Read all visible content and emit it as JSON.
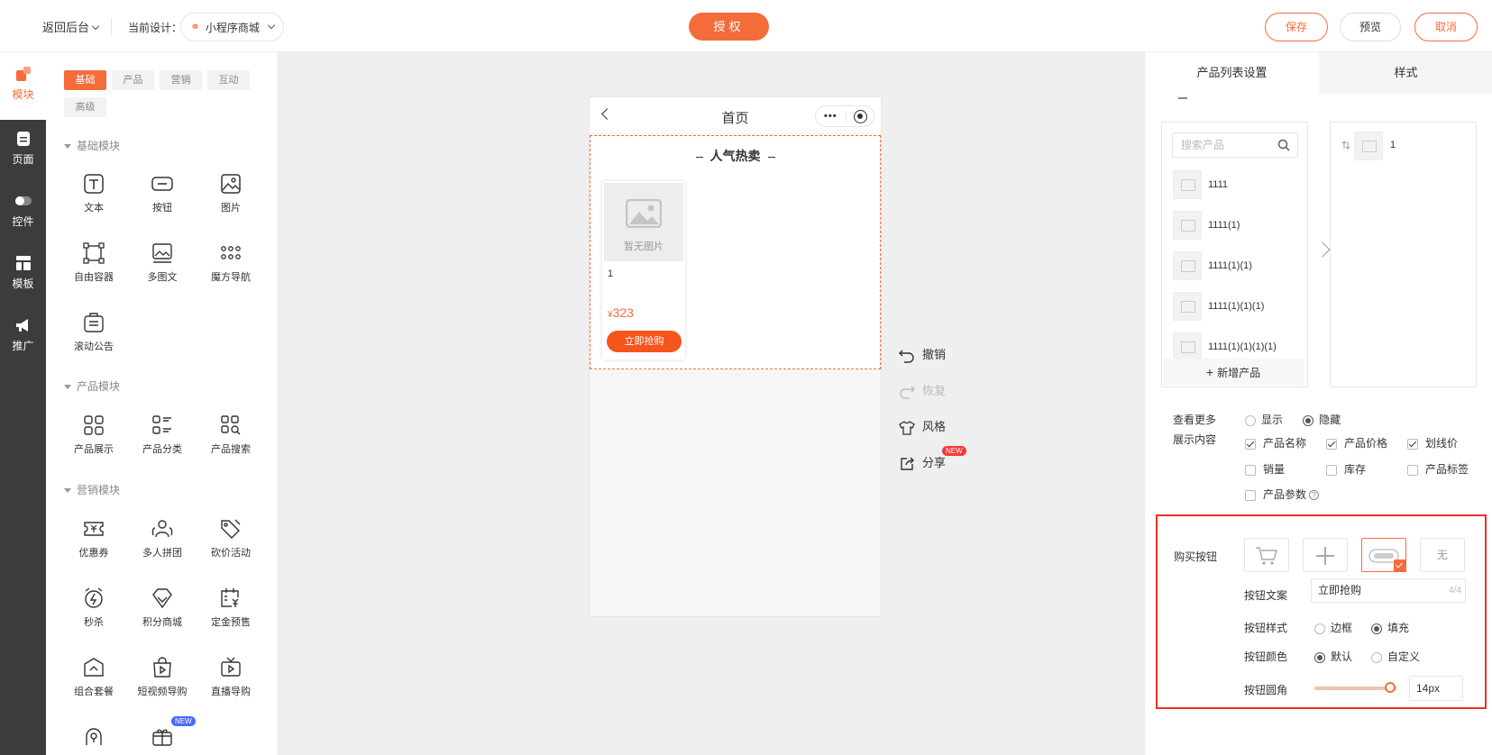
{
  "topbar": {
    "back_label": "返回后台",
    "current_label": "当前设计：",
    "current_value": "小程序商城",
    "auth_label": "授权",
    "save_label": "保存",
    "preview_label": "预览",
    "cancel_label": "取消"
  },
  "leftnav": {
    "items": [
      {
        "label": "模块",
        "icon": "module-icon"
      },
      {
        "label": "页面",
        "icon": "page-icon"
      },
      {
        "label": "控件",
        "icon": "toggle-icon"
      },
      {
        "label": "模板",
        "icon": "template-icon"
      },
      {
        "label": "推广",
        "icon": "megaphone-icon"
      }
    ]
  },
  "modpanel": {
    "tabs": [
      "基础",
      "产品",
      "营销",
      "互动",
      "高级"
    ],
    "sections": {
      "basic": "基础模块",
      "product": "产品模块",
      "marketing": "营销模块"
    },
    "basic_items": [
      "文本",
      "按钮",
      "图片",
      "自由容器",
      "多图文",
      "魔方导航",
      "滚动公告"
    ],
    "product_items": [
      "产品展示",
      "产品分类",
      "产品搜索"
    ],
    "marketing_items": [
      "优惠券",
      "多人拼团",
      "砍价活动",
      "秒杀",
      "积分商城",
      "定金预售",
      "组合套餐",
      "短视频导购",
      "直播导购"
    ],
    "new_badge": "NEW"
  },
  "phone": {
    "title": "首页",
    "section_title": "人气热卖",
    "product": {
      "no_image": "暂无图片",
      "name": "1",
      "currency": "¥",
      "price": "323",
      "buy_label": "立即抢购"
    }
  },
  "side_actions": {
    "undo": "撤销",
    "redo": "恢复",
    "style": "风格",
    "share": "分享",
    "share_badge": "NEW"
  },
  "rpanel": {
    "tabs": [
      "产品列表设置",
      "样式"
    ],
    "search_placeholder": "搜索产品",
    "products": [
      "1111",
      "1111(1)",
      "1111(1)(1)",
      "1111(1)(1)(1)",
      "1111(1)(1)(1)(1)"
    ],
    "add_product": "新增产品",
    "selected": [
      "1"
    ],
    "view_more_label": "查看更多",
    "view_more_options": [
      "显示",
      "隐藏"
    ],
    "view_more_selected": "隐藏",
    "display_label": "展示内容",
    "display_options": [
      {
        "label": "产品名称",
        "checked": true
      },
      {
        "label": "产品价格",
        "checked": true
      },
      {
        "label": "划线价",
        "checked": true
      },
      {
        "label": "销量",
        "checked": false
      },
      {
        "label": "库存",
        "checked": false
      },
      {
        "label": "产品标签",
        "checked": false
      },
      {
        "label": "产品参数",
        "checked": false
      }
    ],
    "buy_button_label": "购买按钮",
    "buy_button_none": "无",
    "button_text_label": "按钮文案",
    "button_text_value": "立即抢购",
    "button_text_count": "4/4",
    "button_style_label": "按钮样式",
    "button_style_options": [
      "边框",
      "填充"
    ],
    "button_style_selected": "填充",
    "button_color_label": "按钮颜色",
    "button_color_options": [
      "默认",
      "自定义"
    ],
    "button_color_selected": "默认",
    "button_radius_label": "按钮圆角",
    "button_radius_value": "14px",
    "button_radius_level": 0.9
  },
  "colors": {
    "accent": "#f56c3b",
    "highlight_border": "#e8322d",
    "sidebar_bg": "#3c3c3c"
  }
}
